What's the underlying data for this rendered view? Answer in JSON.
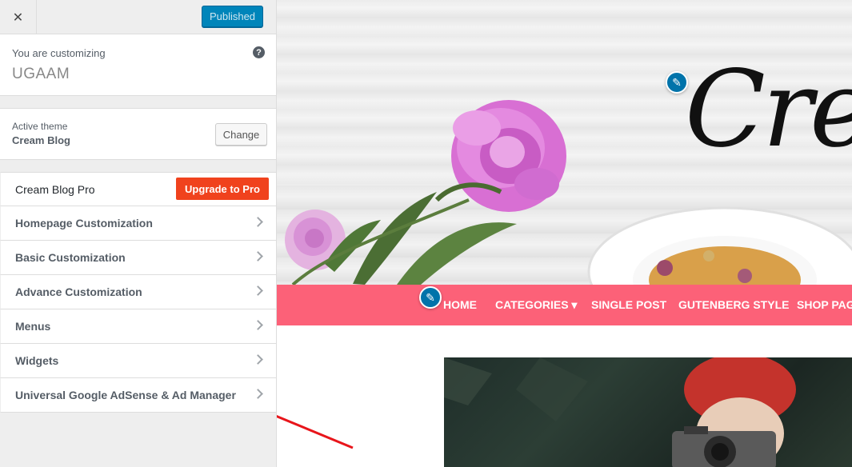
{
  "header": {
    "close_symbol": "✕",
    "published_label": "Published"
  },
  "customizing": {
    "label": "You are customizing",
    "site_name": "UGAAM",
    "help_symbol": "?"
  },
  "theme": {
    "label": "Active theme",
    "name": "Cream Blog",
    "change_label": "Change"
  },
  "menu": {
    "pro_label": "Cream Blog Pro",
    "upgrade_label": "Upgrade to Pro",
    "items": [
      {
        "label": "Homepage Customization"
      },
      {
        "label": "Basic Customization"
      },
      {
        "label": "Advance Customization"
      },
      {
        "label": "Menus"
      },
      {
        "label": "Widgets"
      },
      {
        "label": "Universal Google AdSense & Ad Manager"
      }
    ]
  },
  "preview": {
    "logo_text": "Cream",
    "nav": [
      "HOME",
      "CATEGORIES ▾",
      "SINGLE POST",
      "GUTENBERG STYLE",
      "SHOP PAG"
    ],
    "colors": {
      "nav_bg": "#fc6178",
      "accent_blue": "#0073aa",
      "upgrade": "#f0421d",
      "arrow": "#e8151b"
    }
  },
  "icons": {
    "edit": "pencil-icon",
    "close": "close-icon",
    "help": "help-icon",
    "chevron": "chevron-right-icon"
  }
}
